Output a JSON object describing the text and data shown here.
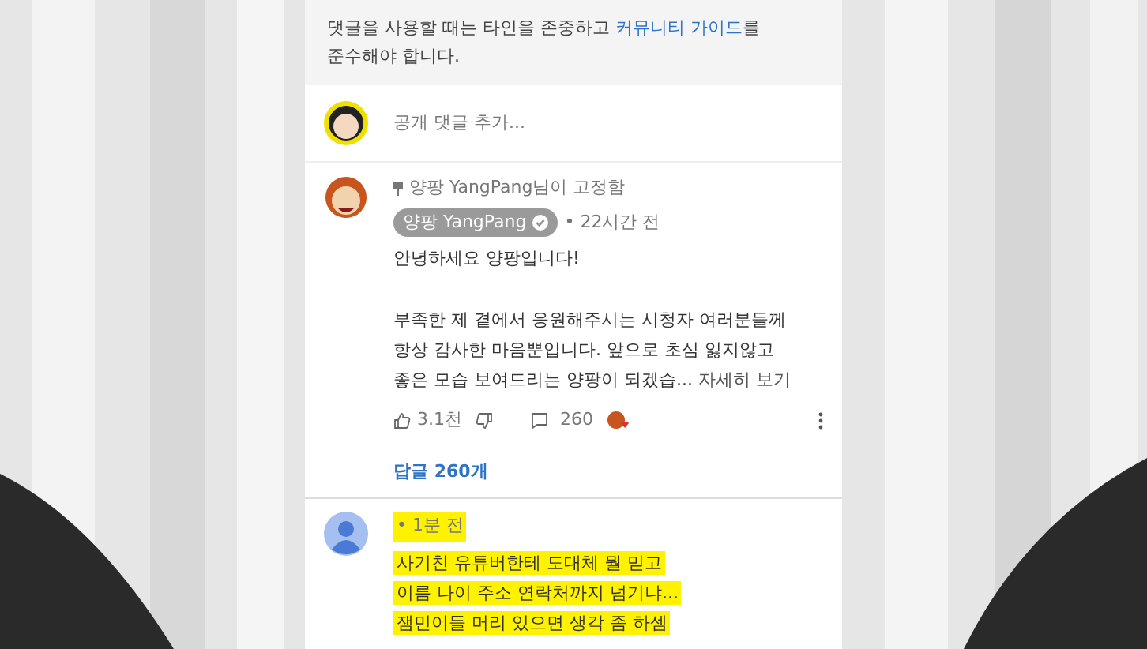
{
  "guidelines": {
    "text": "댓글을 사용할 때는 타인을 존중하고 ",
    "link": "커뮤니티 가이드",
    "text_after": "를\n준수해야 합니다."
  },
  "comment_input": {
    "placeholder": "공개 댓글 추가..."
  },
  "comments": [
    {
      "kind": "pinned",
      "pinned_label": "양팡 YangPang님이 고정함",
      "author": "양팡 YangPang",
      "verified": true,
      "time": "• 22시간 전",
      "text": "안녕하세요 양팡입니다!\n\n부족한 제 곁에서 응원해주시는 시청자 여러분들께\n항상 감사한 마음뿐입니다. 앞으로 초심 잃지않고\n좋은 모습 보여드리는 양팡이 되겠습... ",
      "more": "자세히 보기",
      "likes": "3.1천",
      "replies_count": "260",
      "creator_hearted": true,
      "replies_link": "답글 260개",
      "highlighted": false
    },
    {
      "kind": "plain",
      "time": "• 1분 전",
      "text": "사기친 유튜버한테 도대체 뭘 믿고\n이름 나이 주소 연락처까지 넘기냐...\n잼민이들 머리 있으면 생각 좀 하셈",
      "highlighted": true
    }
  ]
}
